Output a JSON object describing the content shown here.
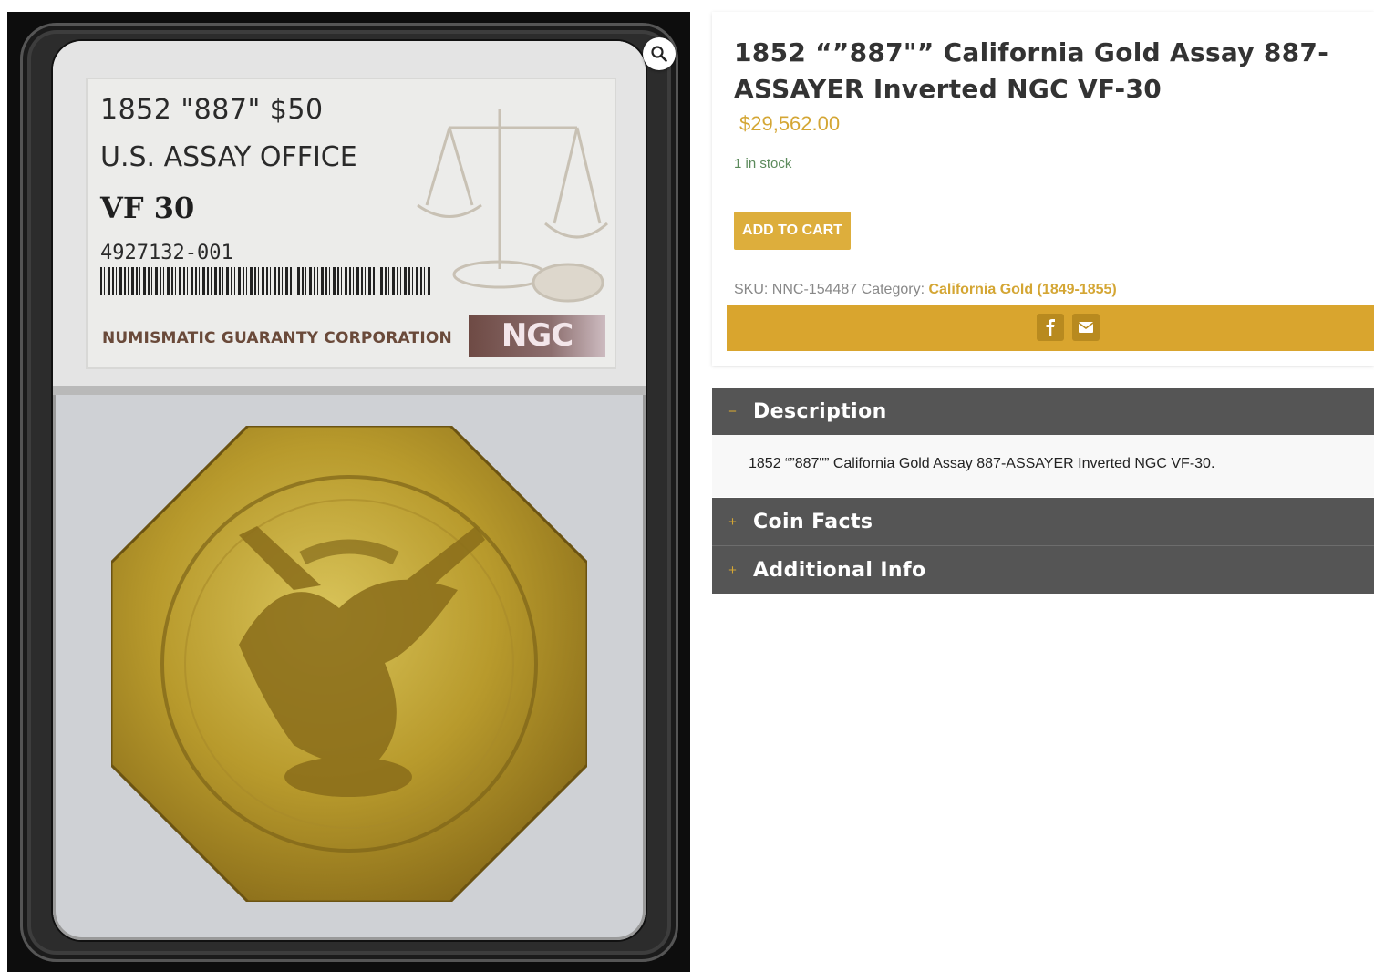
{
  "gallery": {
    "zoom_icon": "magnifier-icon",
    "slab_label": {
      "line1": "1852 \"887\"  $50",
      "line2": "U.S. ASSAY OFFICE",
      "grade": "VF 30",
      "cert": "4927132-001",
      "corporation": "NUMISMATIC GUARANTY CORPORATION",
      "logo": "NGC"
    }
  },
  "product": {
    "title": "1852 “”887\"” California Gold Assay 887-ASSAYER Inverted NGC VF-30",
    "price": "$29,562.00",
    "stock": "1 in stock",
    "add_to_cart": "ADD TO CART",
    "sku_label": "SKU:",
    "sku": "NNC-154487",
    "category_label": "Category:",
    "category": "California Gold (1849-1855)"
  },
  "share": {
    "icons": [
      "facebook-icon",
      "email-icon"
    ],
    "accent_color": "#d9a52e"
  },
  "tabs": {
    "description": {
      "sign": "−",
      "label": "Description",
      "content": "1852 “”887\"” California Gold Assay 887-ASSAYER Inverted NGC VF-30."
    },
    "coin_facts": {
      "sign": "+",
      "label": "Coin Facts"
    },
    "additional_info": {
      "sign": "+",
      "label": "Additional Info"
    }
  },
  "colors": {
    "gold_accent": "#d4a634",
    "tab_header": "#555555",
    "stock_green": "#5b8a5b"
  }
}
